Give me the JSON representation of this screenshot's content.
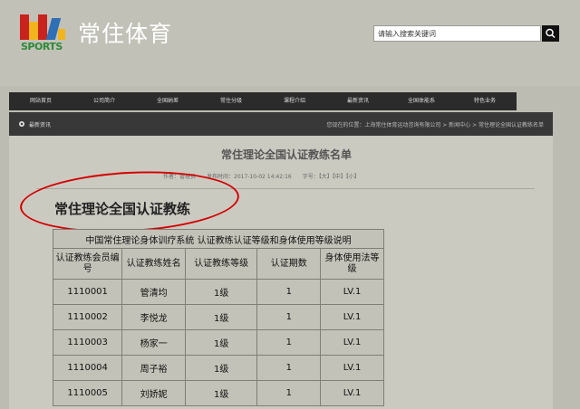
{
  "header": {
    "logo_text": "SPORTS",
    "site_title": "常住体育",
    "search_placeholder": "请输入搜索关键词",
    "colors": {
      "logo_red": "#c8231e",
      "logo_yellow": "#f2b41c",
      "logo_blue": "#2f6fb5",
      "logo_green": "#2e8a3a"
    }
  },
  "nav": {
    "items": [
      "网站首页",
      "公司简介",
      "全国纳差",
      "常住分级",
      "课程介绍",
      "最新资讯",
      "全国体能系",
      "特色业务"
    ]
  },
  "subbar": {
    "left": "最新资讯",
    "right": "您现在的位置：上海常住体育运动咨询有限公司 > 新闻中心 > 常住理论全国认证教练名单"
  },
  "article": {
    "title": "常住理论全国认证教练名单",
    "meta": "作者：管理员　　发布时间：2017-10-02 14:42:16　　字号：【大】【中】【小】"
  },
  "section_title": "常住理论全国认证教练",
  "table": {
    "caption": "中国常住理论身体训疗系统 认证教练认证等级和身体使用等级说明",
    "headers": [
      "认证教练会员编号",
      "认证教练姓名",
      "认证教练等级",
      "认证期数",
      "身体使用法等级"
    ],
    "rows": [
      [
        "1110001",
        "管清均",
        "1级",
        "1",
        "LV.1"
      ],
      [
        "1110002",
        "李悦龙",
        "1级",
        "1",
        "LV.1"
      ],
      [
        "1110003",
        "杨家一",
        "1级",
        "1",
        "LV.1"
      ],
      [
        "1110004",
        "周子裕",
        "1级",
        "1",
        "LV.1"
      ],
      [
        "1110005",
        "刘娇妮",
        "1级",
        "1",
        "LV.1"
      ]
    ]
  }
}
